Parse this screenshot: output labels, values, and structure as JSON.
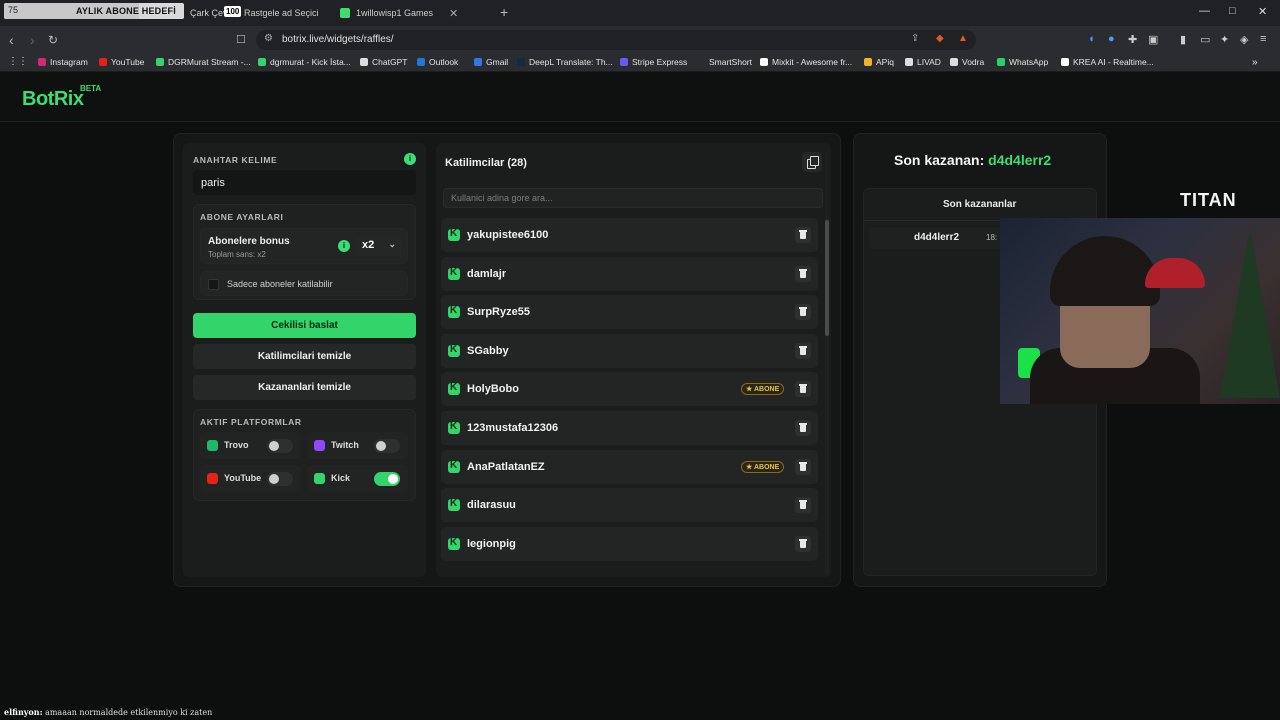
{
  "overlay": {
    "counter": "75",
    "goal_label": "AYLIK ABONE HEDEFİ",
    "goal_badge": "100",
    "goal_progress": 0.75
  },
  "tabs": [
    {
      "label": "Çark Çevir"
    },
    {
      "label": "Rastgele ad Seçici"
    },
    {
      "label": "1willowisp1 Games"
    }
  ],
  "browser": {
    "url": "botrix.live/widgets/raffles/"
  },
  "bookmarks": [
    {
      "label": "Instagram",
      "color": "#d6287a"
    },
    {
      "label": "YouTube",
      "color": "#e62117"
    },
    {
      "label": "DGRMurat Stream -...",
      "color": "#33d46a"
    },
    {
      "label": "dgrmurat - Kick İsta...",
      "color": "#33d46a"
    },
    {
      "label": "ChatGPT",
      "color": "#dddddd"
    },
    {
      "label": "Outlook",
      "color": "#1e78d6"
    },
    {
      "label": "Gmail",
      "color": "#2d7be6"
    },
    {
      "label": "DeepL Translate: Th...",
      "color": "#0f2b46"
    },
    {
      "label": "Stripe Express",
      "color": "#635bff"
    },
    {
      "label": "SmartShort",
      "color": "#2b2c2f"
    },
    {
      "label": "Mixkit - Awesome fr...",
      "color": "#ffffff"
    },
    {
      "label": "APiq",
      "color": "#f0b429"
    },
    {
      "label": "LIVAD",
      "color": "#dddddd"
    },
    {
      "label": "Vodra",
      "color": "#dddddd"
    },
    {
      "label": "WhatsApp",
      "color": "#25d366"
    },
    {
      "label": "KREA AI - Realtime...",
      "color": "#ffffff"
    }
  ],
  "app": {
    "logo": "BotRix",
    "logo_badge": "BETA",
    "keyword": {
      "title": "ANAHTAR KELIME",
      "value": "paris"
    },
    "subscriber": {
      "title": "ABONE AYARLARI",
      "bonus_label": "Abonelere bonus",
      "bonus_sub": "Toplam sans: x2",
      "multiplier": "x2",
      "subs_only_label": "Sadece aboneler katilabilir"
    },
    "buttons": {
      "start": "Cekilisi baslat",
      "clear_participants": "Katilimcilari temizle",
      "clear_winners": "Kazananlari temizle"
    },
    "platforms": {
      "title": "AKTIF PLATFORMLAR",
      "items": [
        {
          "name": "Trovo",
          "color": "#1fb86a",
          "enabled": false
        },
        {
          "name": "Twitch",
          "color": "#9146ff",
          "enabled": false
        },
        {
          "name": "YouTube",
          "color": "#e62117",
          "enabled": false
        },
        {
          "name": "Kick",
          "color": "#33d46a",
          "enabled": true
        }
      ]
    },
    "participants": {
      "title": "Katilimcilar (28)",
      "search_placeholder": "Kullanici adina gore ara...",
      "badge_label": "ABONE",
      "rows": [
        {
          "name": "yakupistee6100",
          "subscriber": false
        },
        {
          "name": "damlajr",
          "subscriber": false
        },
        {
          "name": "SurpRyze55",
          "subscriber": false
        },
        {
          "name": "SGabby",
          "subscriber": false
        },
        {
          "name": "HolyBobo",
          "subscriber": true
        },
        {
          "name": "123mustafa12306",
          "subscriber": false
        },
        {
          "name": "AnaPatlatanEZ",
          "subscriber": true
        },
        {
          "name": "dilarasuu",
          "subscriber": false
        },
        {
          "name": "legionpig",
          "subscriber": false
        }
      ]
    },
    "winners": {
      "last_winner_label": "Son kazanan:",
      "last_winner_name": "d4d4lerr2",
      "list_title": "Son kazananlar",
      "rows": [
        {
          "name": "d4d4lerr2",
          "time": "18:"
        }
      ]
    }
  },
  "stream_overlay": {
    "sponsor_logo": "TITAN",
    "chat_user": "elfinyon:",
    "chat_message": "amaaan normaldede etkilenmiyo ki zaten"
  }
}
